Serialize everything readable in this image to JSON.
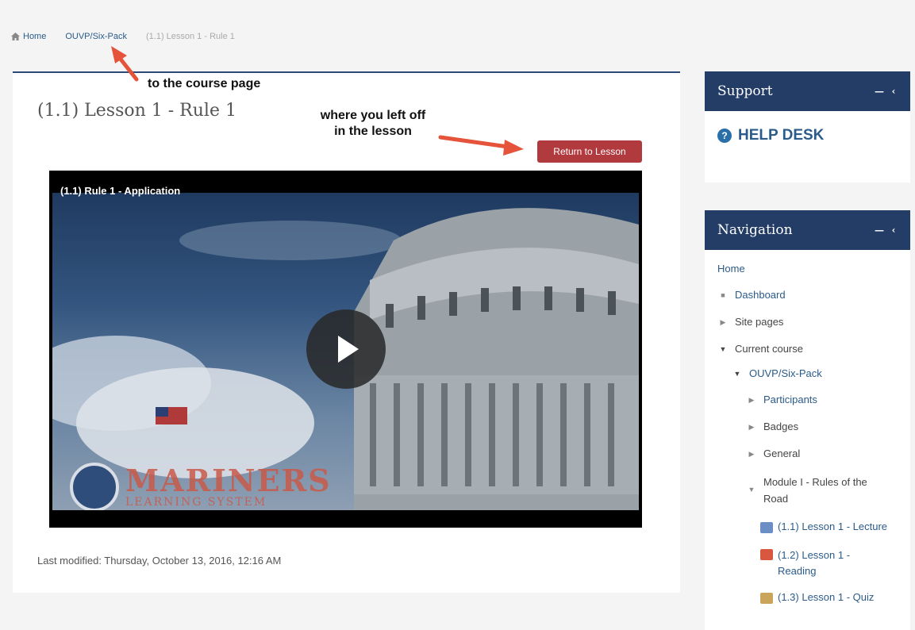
{
  "breadcrumb": {
    "home": "Home",
    "course": "OUVP/Six-Pack",
    "current": "(1.1) Lesson 1 - Rule 1"
  },
  "main": {
    "title": "(1.1) Lesson 1 - Rule 1",
    "return_button": "Return to Lesson",
    "video_title": "(1.1) Rule 1 - Application",
    "watermark_main": "MARINERS",
    "watermark_sub": "LEARNING SYSTEM",
    "last_modified": "Last modified: Thursday, October 13, 2016, 12:16 AM"
  },
  "annotations": {
    "course_page": "to the course page",
    "left_off_line1": "where you left off",
    "left_off_line2": "in the lesson"
  },
  "support": {
    "title": "Support",
    "helpdesk": "HELP DESK"
  },
  "navigation": {
    "title": "Navigation",
    "home": "Home",
    "dashboard": "Dashboard",
    "site_pages": "Site pages",
    "current_course": "Current course",
    "course": "OUVP/Six-Pack",
    "participants": "Participants",
    "badges": "Badges",
    "general": "General",
    "module_line1": "Module I - Rules of the",
    "module_line2": "Road",
    "lecture": "(1.1) Lesson 1 - Lecture",
    "reading_line1": "(1.2) Lesson 1 -",
    "reading_line2": "Reading",
    "quiz": "(1.3) Lesson 1 - Quiz"
  },
  "colors": {
    "header_navy": "#243d66",
    "button_red": "#b13a3f",
    "link_blue": "#2a5b8a",
    "annotation_arrow": "#e4533a"
  }
}
